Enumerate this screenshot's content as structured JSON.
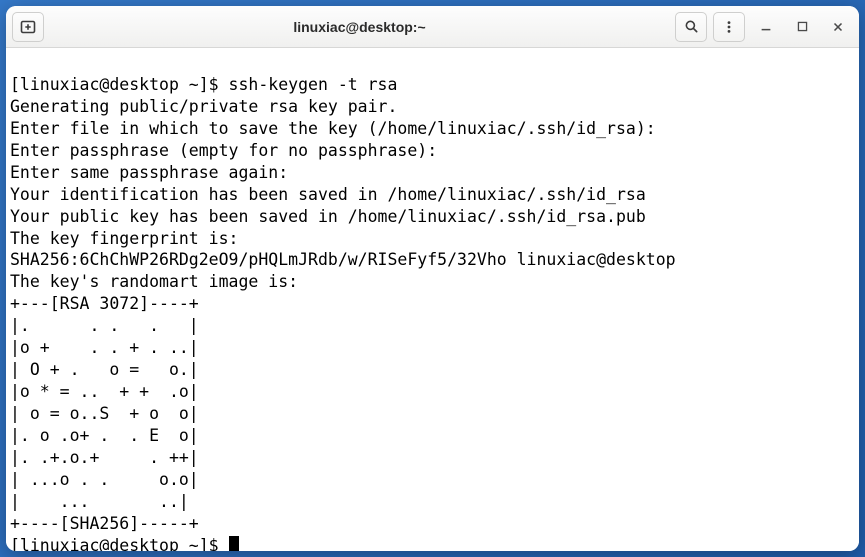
{
  "window": {
    "title": "linuxiac@desktop:~"
  },
  "terminal": {
    "prompt1": "[linuxiac@desktop ~]$ ",
    "command1": "ssh-keygen -t rsa",
    "lines": [
      "Generating public/private rsa key pair.",
      "Enter file in which to save the key (/home/linuxiac/.ssh/id_rsa):",
      "Enter passphrase (empty for no passphrase):",
      "Enter same passphrase again:",
      "Your identification has been saved in /home/linuxiac/.ssh/id_rsa",
      "Your public key has been saved in /home/linuxiac/.ssh/id_rsa.pub",
      "The key fingerprint is:",
      "SHA256:6ChChWP26RDg2eO9/pHQLmJRdb/w/RISeFyf5/32Vho linuxiac@desktop",
      "The key's randomart image is:",
      "+---[RSA 3072]----+",
      "|.      . .   .   |",
      "|o +    . . + . ..|",
      "| O + .   o =   o.|",
      "|o * = ..  + +  .o|",
      "| o = o..S  + o  o|",
      "|. o .o+ .  . E  o|",
      "|. .+.o.+     . ++|",
      "| ...o . .     o.o|",
      "|    ...       ..|",
      "+----[SHA256]-----+"
    ],
    "prompt2": "[linuxiac@desktop ~]$ "
  }
}
